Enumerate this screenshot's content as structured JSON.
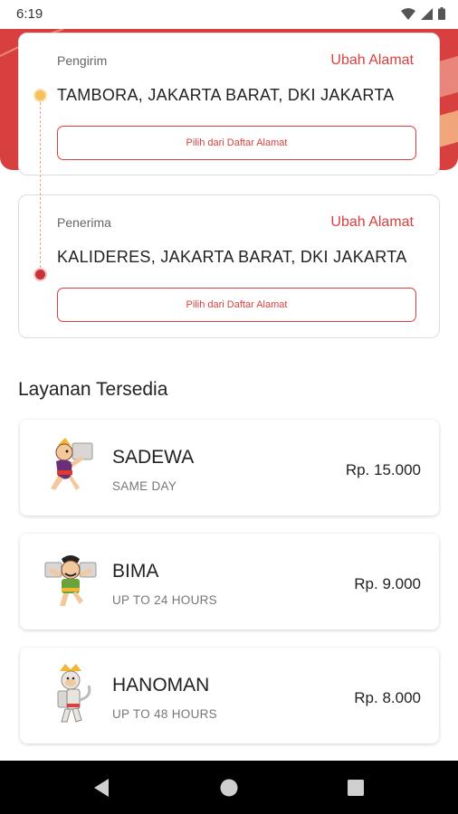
{
  "status_bar": {
    "time": "6:19"
  },
  "sender": {
    "role_label": "Pengirim",
    "change_label": "Ubah Alamat",
    "address": "TAMBORA, JAKARTA BARAT, DKI JAKARTA",
    "pick_label": "Pilih dari Daftar Alamat"
  },
  "receiver": {
    "role_label": "Penerima",
    "change_label": "Ubah Alamat",
    "address": "KALIDERES, JAKARTA BARAT, DKI JAKARTA",
    "pick_label": "Pilih dari Daftar Alamat"
  },
  "services": {
    "title": "Layanan Tersedia",
    "items": [
      {
        "name": "SADEWA",
        "eta": "SAME DAY",
        "price": "Rp. 15.000",
        "icon": "sadewa-mascot-icon"
      },
      {
        "name": "BIMA",
        "eta": "UP TO 24 HOURS",
        "price": "Rp. 9.000",
        "icon": "bima-mascot-icon"
      },
      {
        "name": "HANOMAN",
        "eta": "UP TO 48 HOURS",
        "price": "Rp. 8.000",
        "icon": "hanoman-mascot-icon"
      }
    ]
  },
  "colors": {
    "accent": "#d8403f",
    "accent_light": "#e9867c",
    "sender_dot": "#f4c15a",
    "nav_bar": "#000000"
  }
}
